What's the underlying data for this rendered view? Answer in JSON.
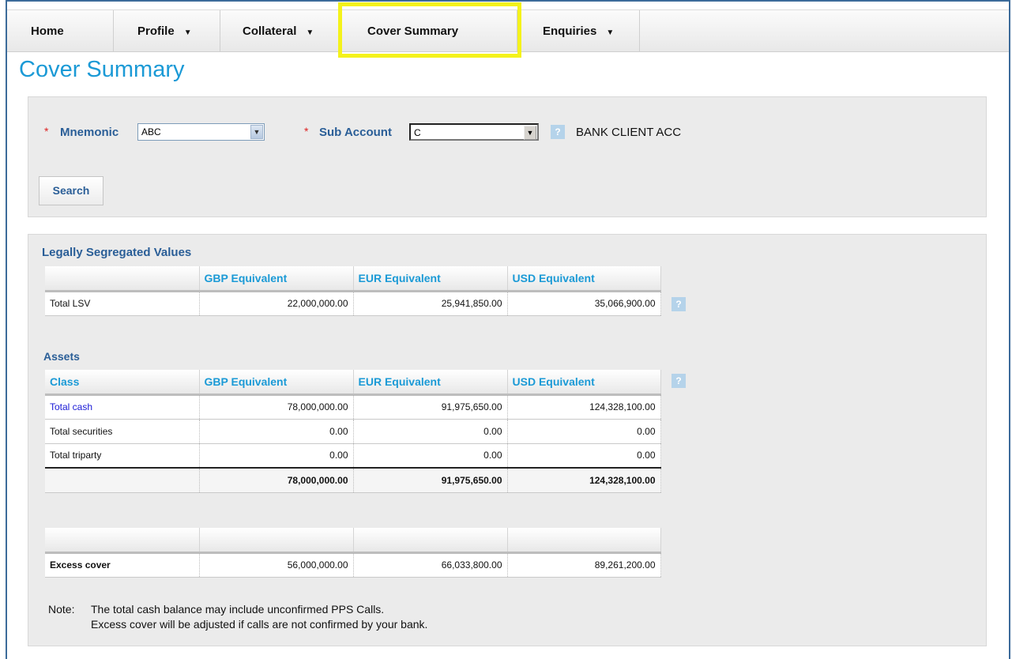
{
  "nav": {
    "home": "Home",
    "profile": "Profile",
    "collateral": "Collateral",
    "cover_summary": "Cover Summary",
    "enquiries": "Enquiries"
  },
  "page_title": "Cover Summary",
  "search": {
    "required_mark": "*",
    "mnemonic_label": "Mnemonic",
    "mnemonic_value": "ABC",
    "sub_account_label": "Sub Account",
    "sub_account_value": "C",
    "help_glyph": "?",
    "account_name": "BANK CLIENT ACC",
    "search_button": "Search"
  },
  "lsv": {
    "title": "Legally Segregated Values",
    "headers": [
      "",
      "GBP Equivalent",
      "EUR Equivalent",
      "USD Equivalent"
    ],
    "row": {
      "label": "Total LSV",
      "gbp": "22,000,000.00",
      "eur": "25,941,850.00",
      "usd": "35,066,900.00"
    }
  },
  "assets": {
    "title": "Assets",
    "headers": [
      "Class",
      "GBP Equivalent",
      "EUR Equivalent",
      "USD Equivalent"
    ],
    "rows": [
      {
        "label": "Total cash",
        "gbp": "78,000,000.00",
        "eur": "91,975,650.00",
        "usd": "124,328,100.00"
      },
      {
        "label": "Total securities",
        "gbp": "0.00",
        "eur": "0.00",
        "usd": "0.00"
      },
      {
        "label": "Total triparty",
        "gbp": "0.00",
        "eur": "0.00",
        "usd": "0.00"
      }
    ],
    "total": {
      "gbp": "78,000,000.00",
      "eur": "91,975,650.00",
      "usd": "124,328,100.00"
    }
  },
  "excess": {
    "label": "Excess cover",
    "gbp": "56,000,000.00",
    "eur": "66,033,800.00",
    "usd": "89,261,200.00"
  },
  "note": {
    "prefix": "Note:",
    "line1": "The total cash balance may include unconfirmed PPS Calls.",
    "line2": "Excess cover will be adjusted if calls are not confirmed by your bank."
  },
  "colors": {
    "accent": "#1b9ad6",
    "label_blue": "#2a5e97",
    "highlight": "#f4f21b",
    "link": "#1a1ad6"
  }
}
